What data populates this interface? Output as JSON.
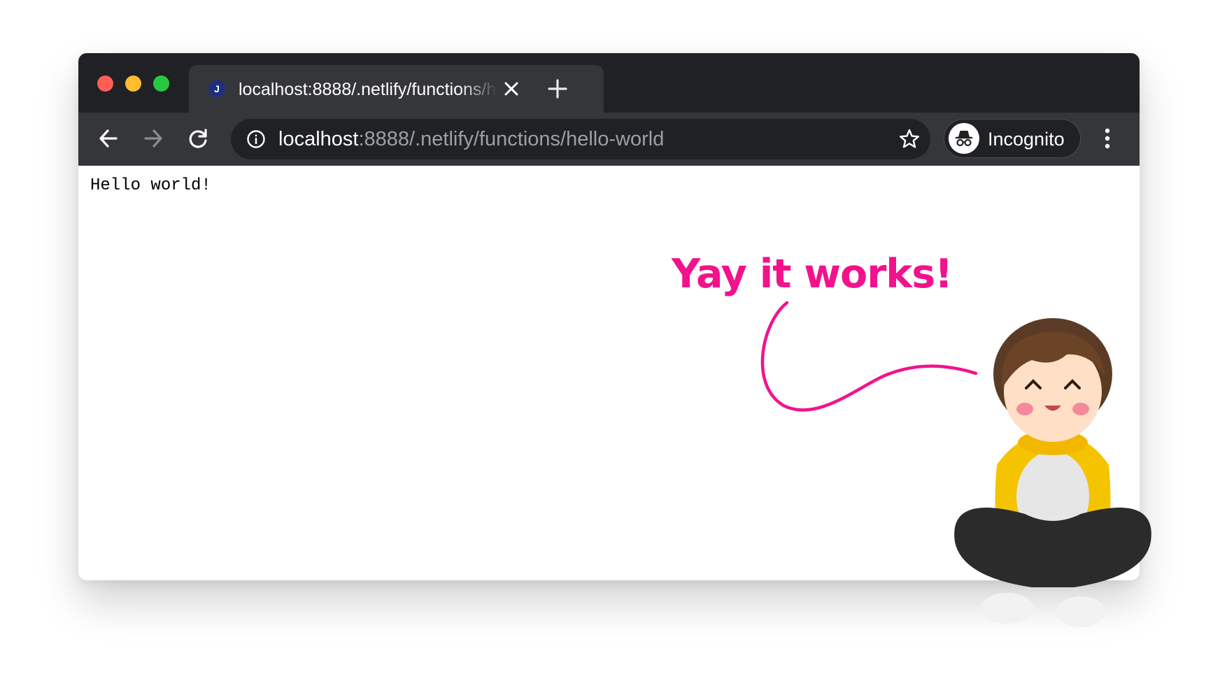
{
  "browser": {
    "tab": {
      "favicon_letter": "J",
      "title": "localhost:8888/.netlify/functions/hello-world"
    },
    "address_bar": {
      "host": "localhost",
      "path": ":8888/.netlify/functions/hello-world"
    },
    "profile": {
      "label": "Incognito"
    }
  },
  "page": {
    "body_text": "Hello world!"
  },
  "annotation": {
    "text": "Yay it works!",
    "color": "#f2128c"
  },
  "icons": {
    "traffic_lights": [
      "close",
      "minimize",
      "zoom"
    ],
    "tab": [
      "favicon",
      "close-icon",
      "plus-icon"
    ],
    "toolbar": [
      "back-arrow-icon",
      "forward-arrow-icon",
      "reload-icon",
      "info-icon",
      "star-icon",
      "incognito-icon",
      "more-vert-icon"
    ]
  }
}
